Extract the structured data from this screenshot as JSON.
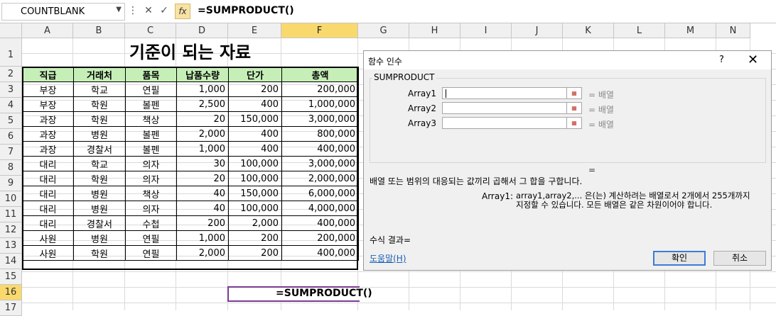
{
  "formula_bar": {
    "name_box": "COUNTBLANK",
    "cancel_glyph": "✕",
    "enter_glyph": "✓",
    "fx_label": "fx",
    "formula": "=SUMPRODUCT()"
  },
  "columns": [
    "A",
    "B",
    "C",
    "D",
    "E",
    "F",
    "G",
    "H",
    "I",
    "J",
    "K",
    "L",
    "M",
    "N"
  ],
  "rows": [
    "1",
    "2",
    "3",
    "4",
    "5",
    "6",
    "7",
    "8",
    "9",
    "10",
    "11",
    "12",
    "13",
    "14",
    "15",
    "16",
    "17"
  ],
  "sheet": {
    "title": "기준이 되는 자료",
    "headers": [
      "직급",
      "거래처",
      "품목",
      "납품수량",
      "단가",
      "총액"
    ],
    "data": [
      [
        "부장",
        "학교",
        "연필",
        "1,000",
        "200",
        "200,000"
      ],
      [
        "부장",
        "학원",
        "볼펜",
        "2,500",
        "400",
        "1,000,000"
      ],
      [
        "과장",
        "학원",
        "책상",
        "20",
        "150,000",
        "3,000,000"
      ],
      [
        "과장",
        "병원",
        "볼펜",
        "2,000",
        "400",
        "800,000"
      ],
      [
        "과장",
        "경찰서",
        "볼펜",
        "1,000",
        "400",
        "400,000"
      ],
      [
        "대리",
        "학교",
        "의자",
        "30",
        "100,000",
        "3,000,000"
      ],
      [
        "대리",
        "학원",
        "의자",
        "20",
        "100,000",
        "2,000,000"
      ],
      [
        "대리",
        "병원",
        "책상",
        "40",
        "150,000",
        "6,000,000"
      ],
      [
        "대리",
        "병원",
        "의자",
        "40",
        "100,000",
        "4,000,000"
      ],
      [
        "대리",
        "경찰서",
        "수첩",
        "200",
        "2,000",
        "400,000"
      ],
      [
        "사원",
        "병원",
        "연필",
        "1,000",
        "200",
        "200,000"
      ],
      [
        "사원",
        "학원",
        "연필",
        "2,000",
        "200",
        "400,000"
      ]
    ],
    "active_cell_text": "=SUMPRODUCT()"
  },
  "dialog": {
    "title": "함수 인수",
    "help_glyph": "?",
    "close_glyph": "✕",
    "function_name": "SUMPRODUCT",
    "args": [
      {
        "label": "Array1",
        "value": "= 배열"
      },
      {
        "label": "Array2",
        "value": "= 배열"
      },
      {
        "label": "Array3",
        "value": "= 배열"
      }
    ],
    "result_eq": "=",
    "description": "배열 또는 범위의 대응되는 값끼리 곱해서 그 합을 구합니다.",
    "arg_desc_name": "Array1:",
    "arg_desc_text": "array1,array2,... 은(는) 계산하려는 배열로서 2개에서 255개까지 지정할 수 있습니다. 모든 배열은 같은 차원이어야 합니다.",
    "formula_result": "수식 결과=",
    "help_link": "도움말(H)",
    "ok": "확인",
    "cancel": "취소"
  }
}
